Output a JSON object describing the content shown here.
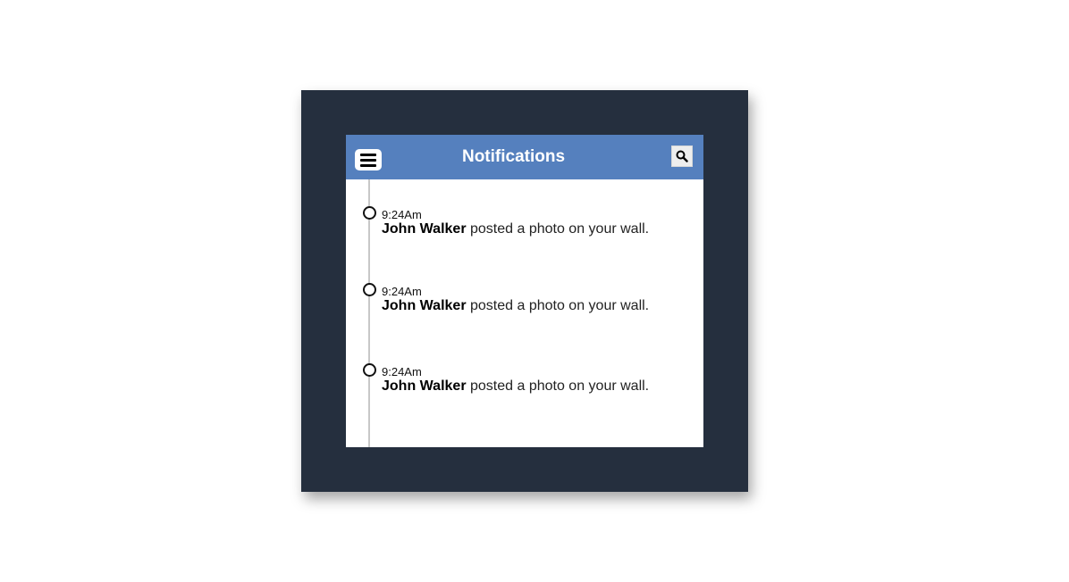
{
  "header": {
    "title": "Notifications",
    "menu_icon": "hamburger-menu-icon",
    "search_icon": "search-icon",
    "background_color": "#5580be"
  },
  "notifications": [
    {
      "time": "9:24Am",
      "name": "John Walker",
      "message": " posted a photo on your wall."
    },
    {
      "time": "9:24Am",
      "name": "John Walker",
      "message": " posted a photo on your wall."
    },
    {
      "time": "9:24Am",
      "name": "John Walker",
      "message": " posted a photo on your wall."
    }
  ],
  "colors": {
    "frame": "#252f3e",
    "timeline": "#c8c8c8"
  }
}
